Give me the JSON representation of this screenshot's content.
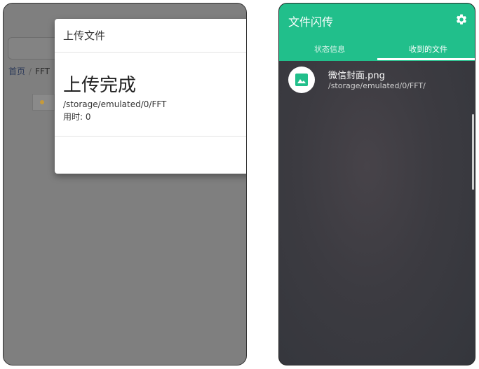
{
  "left": {
    "breadcrumb": {
      "home": "首页",
      "separator": "/",
      "current": "FFT"
    },
    "modal": {
      "title": "上传文件",
      "heading": "上传完成",
      "path": "/storage/emulated/0/FFT",
      "time_label": "用时: 0"
    }
  },
  "right": {
    "app_title": "文件闪传",
    "settings_icon": "gear-icon",
    "tabs": [
      {
        "label": "状态信息",
        "active": false
      },
      {
        "label": "收到的文件",
        "active": true
      }
    ],
    "files": [
      {
        "name": "微信封面.png",
        "path": "/storage/emulated/0/FFT/",
        "icon": "image-icon"
      }
    ],
    "colors": {
      "primary": "#21bf8b",
      "background": "#3c3b41"
    }
  }
}
